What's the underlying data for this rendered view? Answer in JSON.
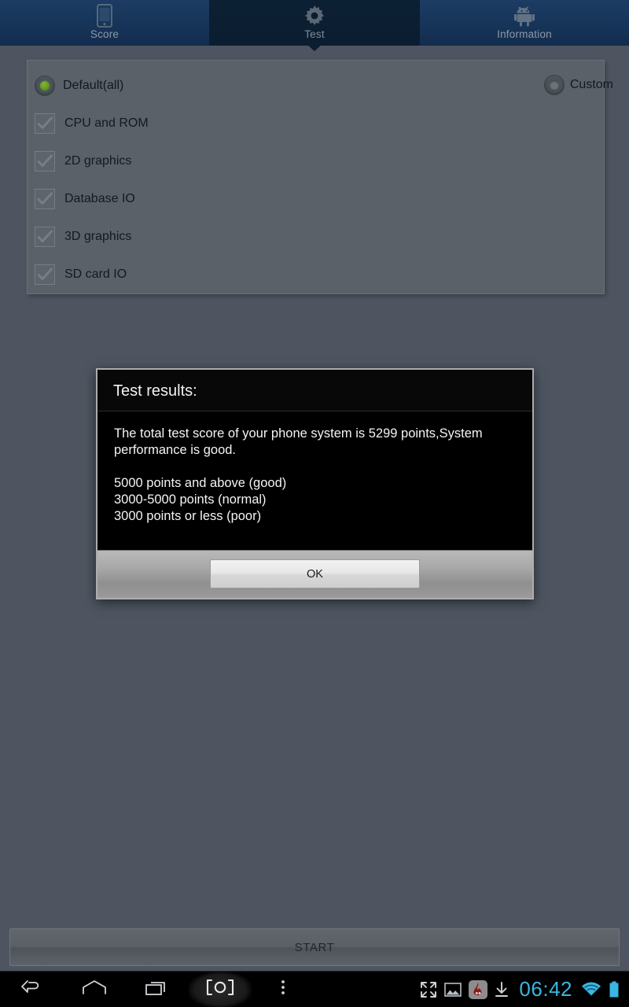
{
  "tabs": [
    {
      "label": "Score",
      "icon": "phone-icon",
      "active": false
    },
    {
      "label": "Test",
      "icon": "gear-icon",
      "active": true
    },
    {
      "label": "Information",
      "icon": "android-robot-icon",
      "active": false
    }
  ],
  "options": {
    "default_radio": {
      "label": "Default(all)",
      "selected": true
    },
    "custom_radio": {
      "label": "Custom",
      "selected": false
    },
    "checkboxes": [
      {
        "label": "CPU and ROM",
        "checked": true
      },
      {
        "label": "2D graphics",
        "checked": true
      },
      {
        "label": "Database IO",
        "checked": true
      },
      {
        "label": "3D graphics",
        "checked": true
      },
      {
        "label": "SD card IO",
        "checked": true
      }
    ]
  },
  "start_button": {
    "label": "START"
  },
  "dialog": {
    "title": "Test results:",
    "summary": "The total test score of your phone system is 5299 points,System performance is good.",
    "legend": [
      "5000 points and above (good)",
      "3000-5000 points (normal)",
      "3000 points or less (poor)"
    ],
    "ok_label": "OK"
  },
  "navbar": {
    "buttons": [
      {
        "name": "back-icon"
      },
      {
        "name": "home-icon"
      },
      {
        "name": "recents-icon"
      },
      {
        "name": "screenshot-capture-icon"
      },
      {
        "name": "overflow-menu-icon"
      }
    ],
    "status": {
      "fullscreen_icon": "fullscreen-icon",
      "gallery_icon": "image-icon",
      "app_icon": "flame-app-icon",
      "download_icon": "download-icon",
      "time": "06:42",
      "wifi_icon": "wifi-icon",
      "battery_icon": "battery-icon"
    }
  },
  "colors": {
    "background": "#4e5560",
    "card": "#5a6169",
    "tab_active": "#0b1d30",
    "tab_inactive": "#17355a",
    "radio_selected": "#5d9121",
    "clock": "#39b6e3",
    "dialog_bg": "#000000"
  }
}
